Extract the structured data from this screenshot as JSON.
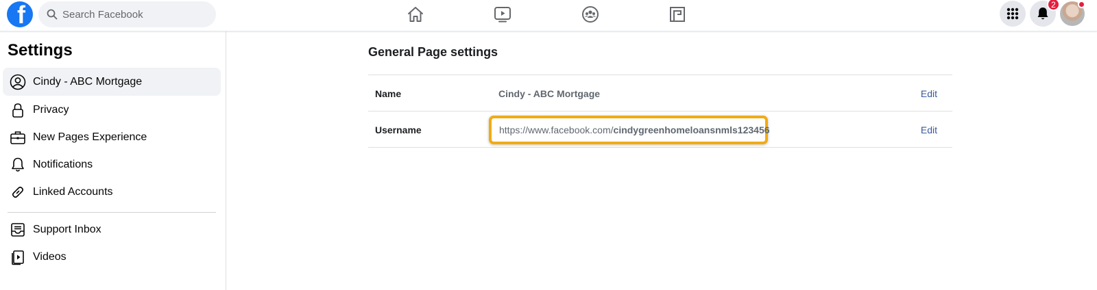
{
  "header": {
    "logo_letter": "f",
    "search_placeholder": "Search Facebook",
    "nav": [
      {
        "icon": "home-icon"
      },
      {
        "icon": "watch-icon"
      },
      {
        "icon": "groups-icon"
      },
      {
        "icon": "gaming-icon"
      }
    ],
    "notification_count": "2",
    "brand_color": "#1877f2",
    "badge_color": "#e41e3f"
  },
  "sidebar": {
    "title": "Settings",
    "items": [
      {
        "label": "Cindy - ABC Mortgage",
        "icon": "profile-icon",
        "active": true
      },
      {
        "label": "Privacy",
        "icon": "lock-icon"
      },
      {
        "label": "New Pages Experience",
        "icon": "briefcase-icon"
      },
      {
        "label": "Notifications",
        "icon": "bell-icon"
      },
      {
        "label": "Linked Accounts",
        "icon": "link-icon"
      }
    ],
    "secondary_items": [
      {
        "label": "Support Inbox",
        "icon": "inbox-icon"
      },
      {
        "label": "Videos",
        "icon": "video-icon"
      }
    ]
  },
  "main": {
    "title": "General Page settings",
    "rows": [
      {
        "key": "Name",
        "value": "Cindy - ABC Mortgage",
        "action": "Edit"
      },
      {
        "key": "Username",
        "url_prefix": "https://www.facebook.com/",
        "url_handle": "cindygreenhomeloansnmls123456",
        "action": "Edit"
      }
    ],
    "highlight_color": "#f2ab13",
    "link_color": "#385898"
  }
}
